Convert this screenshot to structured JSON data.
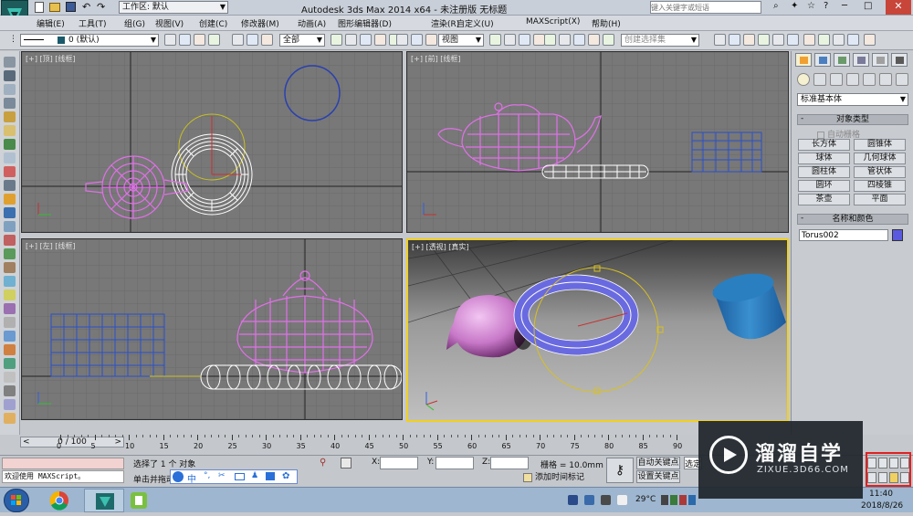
{
  "titlebar": {
    "workspace_label": "工作区: 默认",
    "title": "Autodesk 3ds Max  2014 x64  - 未注册版   无标题",
    "search_placeholder": "键入关键字或短语"
  },
  "menu": [
    "编辑(E)",
    "工具(T)",
    "组(G)",
    "视图(V)",
    "创建(C)",
    "修改器(M)",
    "动画(A)",
    "图形编辑器(D)",
    "渲染(R)",
    "自定义(U)",
    "MAXScript(X)",
    "帮助(H)"
  ],
  "toolbar": {
    "layer_value": "0 (默认)",
    "selection_filter": "全部",
    "ref_coord": "视图",
    "named_selection_placeholder": "创建选择集"
  },
  "viewports": {
    "top": "[+] [顶] [线框]",
    "front": "[+] [前] [线框]",
    "left": "[+] [左] [线框]",
    "perspective": "[+] [透视] [真实]"
  },
  "command_panel": {
    "category": "标准基本体",
    "object_type_header": "对象类型",
    "autogrid_label": "自动栅格",
    "buttons": [
      "长方体",
      "圆锥体",
      "球体",
      "几何球体",
      "圆柱体",
      "管状体",
      "圆环",
      "四棱锥",
      "茶壶",
      "平面"
    ],
    "name_color_header": "名称和颜色",
    "object_name": "Torus002",
    "object_color": "#5a5ae0"
  },
  "timeline": {
    "slider_label": "0 / 100",
    "ticks": [
      "0",
      "5",
      "10",
      "15",
      "20",
      "25",
      "30",
      "35",
      "40",
      "45",
      "50",
      "55",
      "60",
      "65",
      "70",
      "75",
      "80",
      "85",
      "90"
    ]
  },
  "status": {
    "maxscript_text": "欢迎使用 MAXScript。",
    "selection_text": "选择了 1 个 对象",
    "prompt_text": "单击并拖动以选择并旋转",
    "x_label": "X:",
    "y_label": "Y:",
    "z_label": "Z:",
    "grid_text": "栅格 = 10.0mm",
    "auto_key": "自动关键点",
    "set_key": "设置关键点",
    "selected_label": "选定",
    "add_time_tag": "添加时间标记"
  },
  "taskbar": {
    "temperature": "29°C",
    "time": "11:40",
    "date": "2018/8/26"
  },
  "watermark": {
    "brand": "溜溜自学",
    "url": "ZIXUE.3D66.COM"
  },
  "colors": {
    "teapot": "#e070e8",
    "torus_white": "#ffffff",
    "box_blue": "#2a50c8",
    "active_border": "#f0d020",
    "cylinder": "#2a7fc0"
  }
}
